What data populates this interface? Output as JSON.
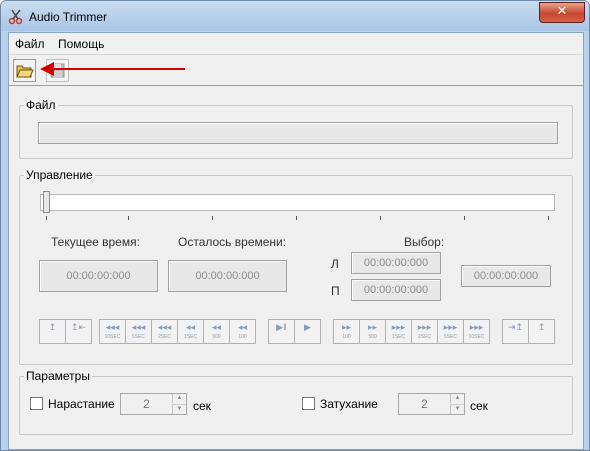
{
  "window": {
    "title": "Audio Trimmer",
    "close_glyph": "✕"
  },
  "menu": {
    "items": [
      "Файл",
      "Помощь"
    ]
  },
  "toolbar": {
    "open_icon": "folder-open-icon",
    "save_icon": "floppy-disk-icon",
    "annotation_color": "#d40000"
  },
  "file_group": {
    "label": "Файл",
    "path": ""
  },
  "control_group": {
    "label": "Управление",
    "current_time_label": "Текущее время:",
    "remaining_label": "Осталось времени:",
    "selection_label": "Выбор:",
    "current_time": "00:00:00:000",
    "remaining_time": "00:00:00:000",
    "left_marker": "Л",
    "right_marker": "П",
    "selection_left": "00:00:00:000",
    "selection_right": "00:00:00:000",
    "selection_length": "00:00:00:000",
    "position_fraction": 0,
    "buttons": [
      {
        "glyph": "↥",
        "sub": ""
      },
      {
        "glyph": "↥⇤",
        "sub": ""
      },
      {
        "glyph": "◂◂◂",
        "sub": "10SEC"
      },
      {
        "glyph": "◂◂◂",
        "sub": "5SEC"
      },
      {
        "glyph": "◂◂◂",
        "sub": "2SEC"
      },
      {
        "glyph": "◂◂",
        "sub": "1SEC"
      },
      {
        "glyph": "◂◂",
        "sub": "500"
      },
      {
        "glyph": "◂◂",
        "sub": "100"
      },
      {
        "glyph": "▶‖",
        "sub": ""
      },
      {
        "glyph": "▶",
        "sub": ""
      },
      {
        "glyph": "▸▸",
        "sub": "100"
      },
      {
        "glyph": "▸▸",
        "sub": "500"
      },
      {
        "glyph": "▸▸▸",
        "sub": "1SEC"
      },
      {
        "glyph": "▸▸▸",
        "sub": "2SEC"
      },
      {
        "glyph": "▸▸▸",
        "sub": "5SEC"
      },
      {
        "glyph": "▸▸▸",
        "sub": "10SEC"
      },
      {
        "glyph": "⇥↥",
        "sub": ""
      },
      {
        "glyph": "↥",
        "sub": ""
      }
    ]
  },
  "params_group": {
    "label": "Параметры",
    "fade_in_label": "Нарастание",
    "fade_in_value": "2",
    "fade_out_label": "Затухание",
    "fade_out_value": "2",
    "unit": "сек"
  }
}
